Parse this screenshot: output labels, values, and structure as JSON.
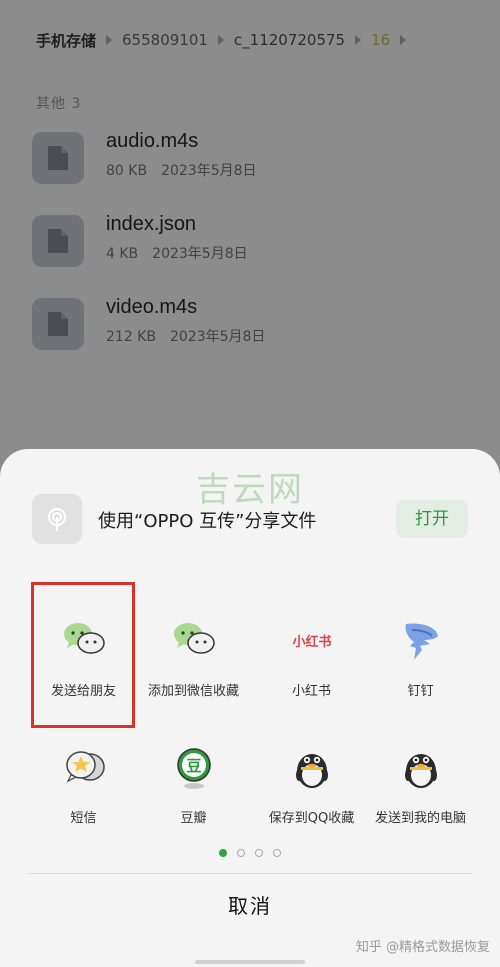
{
  "breadcrumb": {
    "root": "手机存储",
    "items": [
      "655809101",
      "c_1120720575",
      "16"
    ]
  },
  "section_label": "其他 3",
  "files": [
    {
      "name": "audio.m4s",
      "size": "80 KB",
      "date": "2023年5月8日"
    },
    {
      "name": "index.json",
      "size": "4 KB",
      "date": "2023年5月8日"
    },
    {
      "name": "video.m4s",
      "size": "212 KB",
      "date": "2023年5月8日"
    }
  ],
  "watermark": "吉云网",
  "oppo_share": {
    "text": "使用“OPPO 互传”分享文件",
    "open_label": "打开"
  },
  "apps": [
    {
      "label": "发送给朋友",
      "icon": "wechat-icon"
    },
    {
      "label": "添加到微信收藏",
      "icon": "wechat-favorites-icon"
    },
    {
      "label": "小红书",
      "icon": "xiaohongshu-icon",
      "icon_text": "小红书"
    },
    {
      "label": "钉钉",
      "icon": "dingtalk-icon"
    },
    {
      "label": "短信",
      "icon": "sms-icon"
    },
    {
      "label": "豆瓣",
      "icon": "douban-icon",
      "icon_text": "豆"
    },
    {
      "label": "保存到QQ收藏",
      "icon": "qq-icon"
    },
    {
      "label": "发送到我的电脑",
      "icon": "qq-icon"
    }
  ],
  "pager": {
    "pages": 4,
    "current": 1
  },
  "cancel_label": "取消",
  "credit": "知乎 @精格式数据恢复",
  "colors": {
    "accent_green": "#2aa44a",
    "highlight_red": "#d9322b",
    "wechat_green": "#a9d890"
  }
}
